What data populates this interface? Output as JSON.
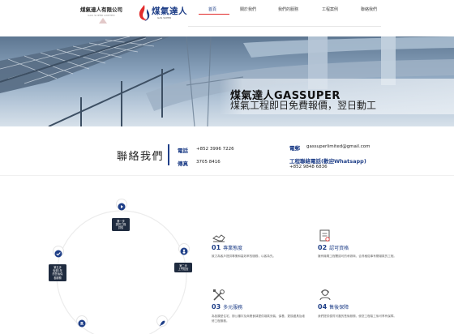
{
  "header": {
    "logo_left": {
      "name": "煤氣達人有限公司",
      "sub": "GAS SUPER LIMITED"
    },
    "logo_right": {
      "brand": "煤氣達人",
      "sub": "GAS SUPER"
    },
    "nav": [
      {
        "label": "首頁",
        "active": true
      },
      {
        "label": "關於我們",
        "active": false
      },
      {
        "label": "我們的服務",
        "active": false
      },
      {
        "label": "工程案例",
        "active": false
      },
      {
        "label": "聯絡我們",
        "active": false
      }
    ]
  },
  "hero": {
    "title": "煤氣達人GASSUPER",
    "subtitle": "煤氣工程即日免費報價，翌日動工"
  },
  "contact": {
    "title": "聯絡我們",
    "phone_label": "電話",
    "phone_value": "+852 3996 7226",
    "fax_label": "傳真",
    "fax_value": "3705 8416",
    "email_label": "電郵",
    "email_value": "gassuperlimited@gmail.com",
    "whatsapp_label": "工程聯絡電話(歡迎Whatsapp)",
    "whatsapp_value": "+852 9848 6836"
  },
  "process": {
    "step1": [
      "第一步",
      "提供工程",
      "詳情"
    ],
    "step2": [
      "第二步",
      "上門檢查"
    ],
    "step5": [
      "第五步",
      "免費1年",
      "的售後保",
      "養服務"
    ]
  },
  "features": [
    {
      "num": "01",
      "title": "專業態度",
      "desc": "致力為客戶提供專業和高效率的服務，以客為先。"
    },
    {
      "num": "02",
      "title": "認可資格",
      "desc": "擁有機電工程署認可的承辦商，合資格從事有關煤氣的工程。"
    },
    {
      "num": "03",
      "title": "多元服務",
      "desc": "為各類型住宅、辦公樓宇及商業食肆提供煤氣安裝、保養、更換爐具及維修工程服務。"
    },
    {
      "num": "04",
      "title": "售後保障",
      "desc": "我們提供優質可靠的售後服務，使您工程竣工後可享有保障。"
    }
  ],
  "colors": {
    "brand_blue": "#1f3f88",
    "accent_red": "#e22c2c"
  }
}
